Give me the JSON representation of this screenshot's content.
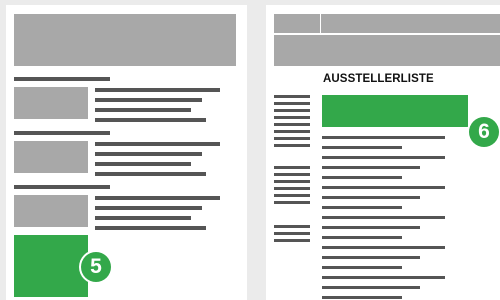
{
  "left_page": {
    "badge": "5"
  },
  "right_page": {
    "title": "AUSSTELLERLISTE",
    "badge": "6"
  },
  "colors": {
    "background": "#ebebeb",
    "page": "#ffffff",
    "placeholder": "#a8a8a8",
    "text_line": "#555555",
    "accent_green": "#33a84a"
  }
}
